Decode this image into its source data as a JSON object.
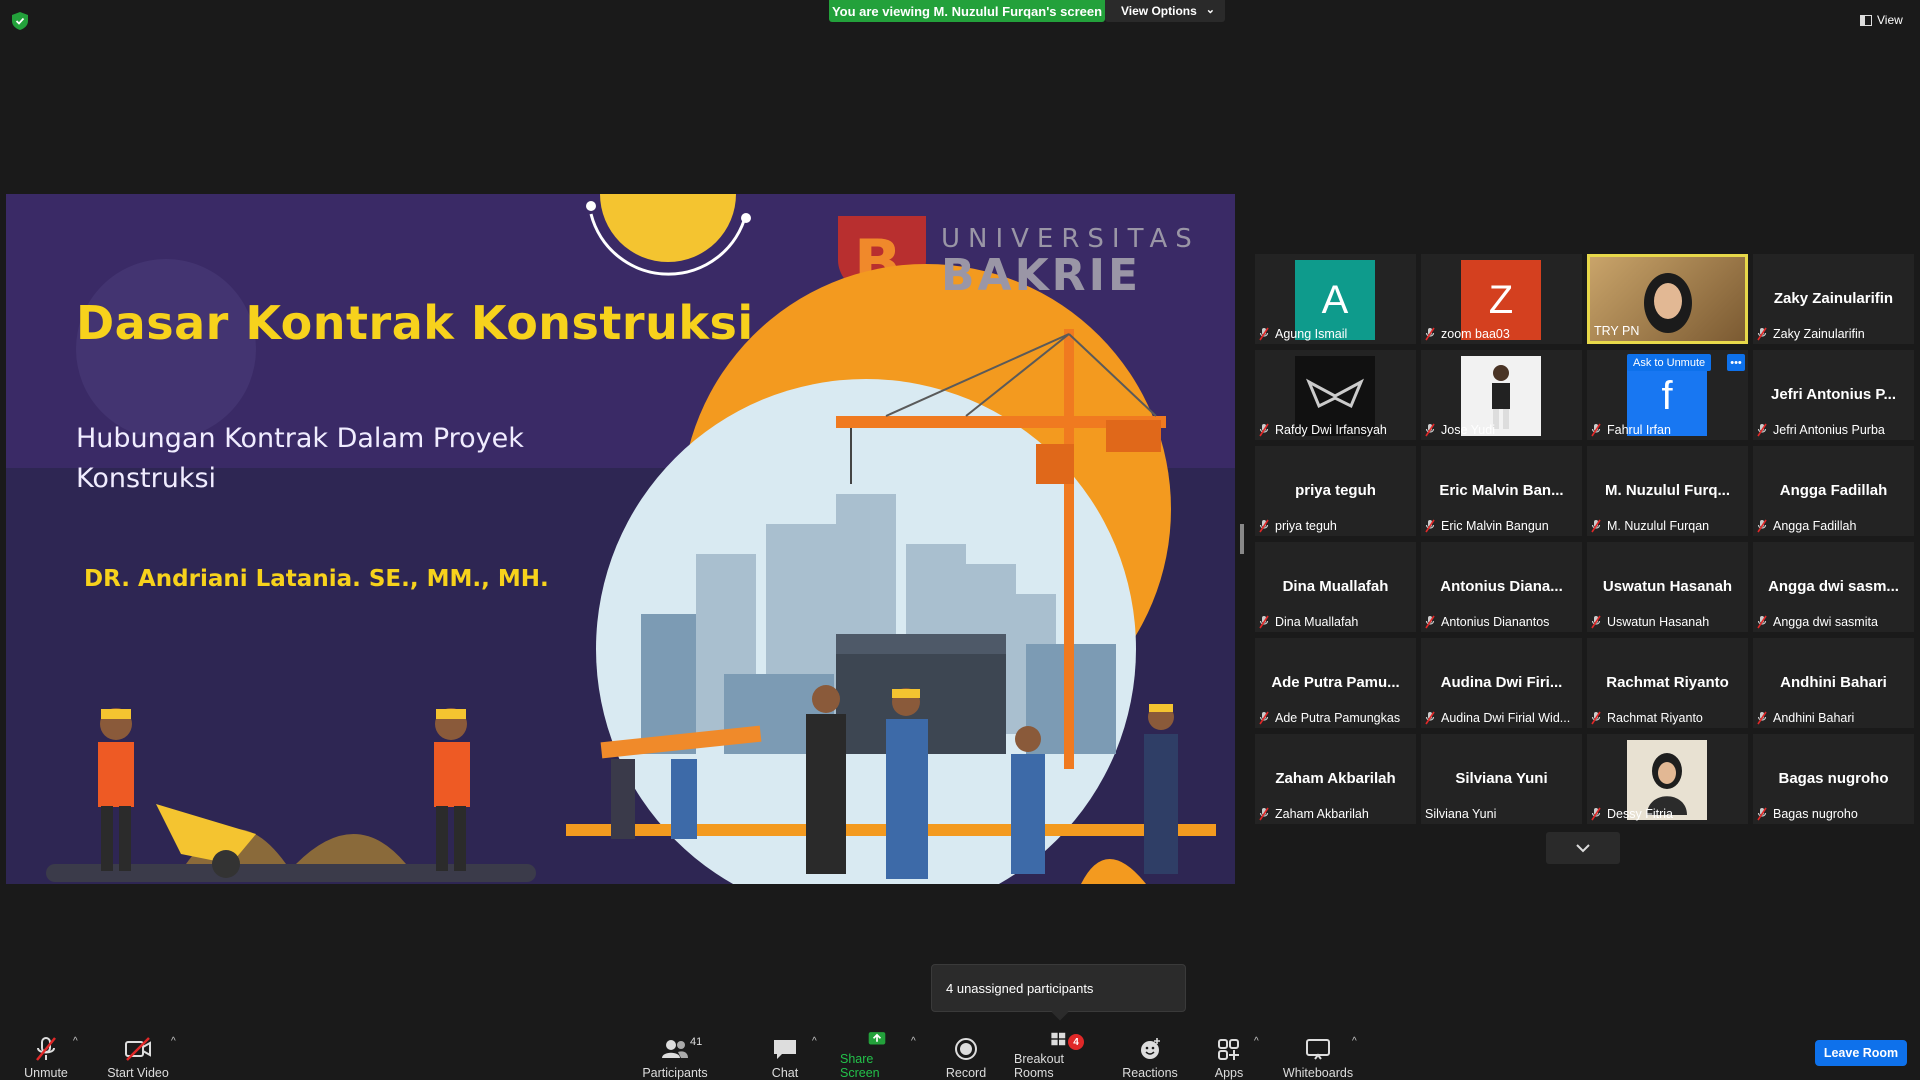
{
  "top": {
    "viewing_banner": "You are viewing M. Nuzulul Furqan's screen",
    "view_options": "View Options",
    "view": "View"
  },
  "slide": {
    "title": "Dasar Kontrak Konstruksi",
    "subtitle": "Hubungan Kontrak Dalam Proyek Konstruksi",
    "author": "DR. Andriani Latania. SE., MM., MH.",
    "logo_line1": "UNIVERSITAS",
    "logo_line2": "BAKRIE"
  },
  "participants": [
    {
      "name": "Agung Ismail",
      "display": "",
      "avatar_letter": "A",
      "avatar_color": "#0e9b8c",
      "muted": true
    },
    {
      "name": "zoom baa03",
      "display": "",
      "avatar_letter": "Z",
      "avatar_color": "#d4401f",
      "muted": true
    },
    {
      "name": "TRY PN",
      "display": "",
      "video": true,
      "muted": false
    },
    {
      "name": "Zaky Zainularifin",
      "display": "Zaky Zainularifin",
      "muted": true
    },
    {
      "name": "Rafdy Dwi Irfansyah",
      "display": "",
      "logo": true,
      "muted": true
    },
    {
      "name": "Jose Yudi",
      "display": "",
      "photo": true,
      "muted": true
    },
    {
      "name": "Fahrul Irfan",
      "display": "",
      "avatar_letter": "f",
      "avatar_color": "#1877f2",
      "muted": true,
      "ask_unmute": "Ask to Unmute"
    },
    {
      "name": "Jefri Antonius Purba",
      "display": "Jefri Antonius P...",
      "muted": true
    },
    {
      "name": "priya teguh",
      "display": "priya teguh",
      "muted": true
    },
    {
      "name": "Eric Malvin Bangun",
      "display": "Eric Malvin Ban...",
      "muted": true
    },
    {
      "name": "M. Nuzulul Furqan",
      "display": "M. Nuzulul Furq...",
      "muted": true
    },
    {
      "name": "Angga Fadillah",
      "display": "Angga Fadillah",
      "muted": true
    },
    {
      "name": "Dina Muallafah",
      "display": "Dina Muallafah",
      "muted": true
    },
    {
      "name": "Antonius Dianantos",
      "display": "Antonius Diana...",
      "muted": true,
      "label": "Antonius Dianantos"
    },
    {
      "name": "Uswatun Hasanah",
      "display": "Uswatun Hasanah",
      "muted": true
    },
    {
      "name": "Angga dwi sasmita",
      "display": "Angga dwi sasm...",
      "muted": true
    },
    {
      "name": "Ade Putra Pamungkas",
      "display": "Ade Putra Pamu...",
      "muted": true
    },
    {
      "name": "Audina Dwi Firial Wid...",
      "display": "Audina Dwi Firi...",
      "muted": true
    },
    {
      "name": "Rachmat Riyanto",
      "display": "Rachmat Riyanto",
      "muted": true
    },
    {
      "name": "Andhini Bahari",
      "display": "Andhini Bahari",
      "muted": true
    },
    {
      "name": "Zaham Akbarilah",
      "display": "Zaham Akbarilah",
      "muted": true
    },
    {
      "name": "Silviana Yuni",
      "display": "Silviana Yuni",
      "muted": false
    },
    {
      "name": "Dessy Fitria",
      "display": "",
      "photo2": true,
      "muted": true
    },
    {
      "name": "Bagas nugroho",
      "display": "Bagas nugroho",
      "muted": true
    }
  ],
  "tooltip": "4 unassigned participants",
  "toolbar": {
    "unmute": "Unmute",
    "start_video": "Start Video",
    "participants": "Participants",
    "participants_count": "41",
    "chat": "Chat",
    "share_screen": "Share Screen",
    "record": "Record",
    "breakout_rooms": "Breakout Rooms",
    "breakout_badge": "4",
    "reactions": "Reactions",
    "apps": "Apps",
    "whiteboards": "Whiteboards",
    "leave_room": "Leave Room"
  },
  "colors": {
    "share_green": "#23a13b",
    "leave_blue": "#0e71eb",
    "slide_yellow": "#f7d21c",
    "slide_purple": "#3a2a66",
    "active_border": "#e7d84a",
    "mute_red": "#e02828"
  }
}
